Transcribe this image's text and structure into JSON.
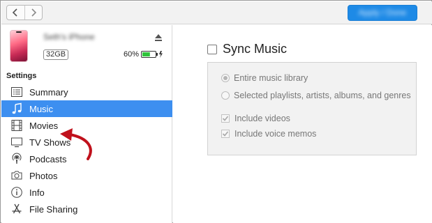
{
  "toolbar": {
    "back_icon": "chevron-left-icon",
    "forward_icon": "chevron-right-icon",
    "apply_label": "Apply / Done",
    "accent": "#1e8ae6"
  },
  "device": {
    "name": "Seth's iPhone",
    "capacity": "32GB",
    "battery_percent": "60%",
    "battery_level": 0.6,
    "battery_color": "#2fc43a"
  },
  "sidebar": {
    "section_label": "Settings",
    "selected_color": "#3d8ff0",
    "items": [
      {
        "label": "Summary",
        "icon": "summary-list-icon"
      },
      {
        "label": "Music",
        "icon": "music-note-icon",
        "active": true
      },
      {
        "label": "Movies",
        "icon": "film-strip-icon"
      },
      {
        "label": "TV Shows",
        "icon": "tv-icon"
      },
      {
        "label": "Podcasts",
        "icon": "podcast-icon"
      },
      {
        "label": "Photos",
        "icon": "camera-icon"
      },
      {
        "label": "Info",
        "icon": "info-icon"
      },
      {
        "label": "File Sharing",
        "icon": "app-store-icon"
      }
    ]
  },
  "main": {
    "sync_label": "Sync Music",
    "sync_checked": false,
    "options": {
      "entire_library": "Entire music library",
      "selected_items": "Selected playlists, artists, albums, and genres",
      "include_videos": "Include videos",
      "include_voice_memos": "Include voice memos"
    }
  },
  "annotation": {
    "arrow_color": "#c0111c"
  }
}
